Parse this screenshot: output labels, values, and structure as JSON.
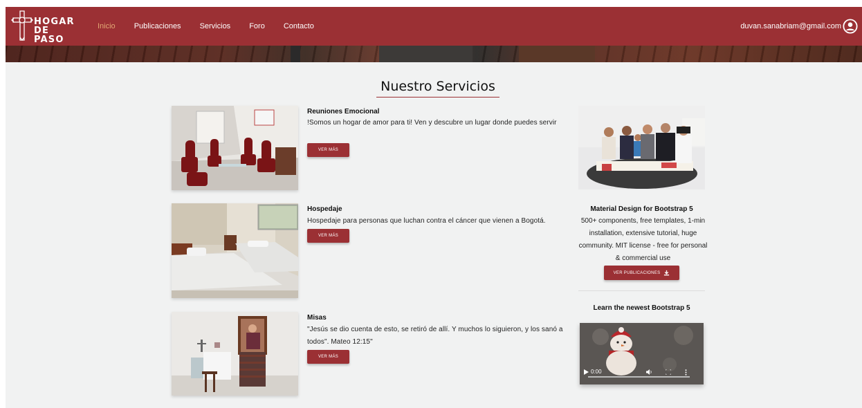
{
  "navbar": {
    "logo_line1": "HOGAR",
    "logo_line2": "DE PASO",
    "links": [
      "Inicio",
      "Publicaciones",
      "Servicios",
      "Foro",
      "Contacto"
    ],
    "active_link": "Inicio",
    "user_email": "duvan.sanabriam@gmail.com",
    "user_icon": "account-circle-icon",
    "brand_color": "#9b3034",
    "active_color": "#e2a874"
  },
  "page": {
    "section_title": "Nuestro Servicios"
  },
  "services": [
    {
      "title": "Reuniones Emocional",
      "description": "!Somos un hogar de amor para ti! Ven y descubre un lugar donde puedes servir",
      "button": "VER MÁS",
      "image": "living-room-photo"
    },
    {
      "title": "Hospedaje",
      "description": "Hospedaje para personas que luchan contra el cáncer que vienen a Bogotá.",
      "button": "VER MÁS",
      "image": "bedroom-photo"
    },
    {
      "title": "Misas",
      "description": "\"Jesús se dio cuenta de esto, se retiró de allí. Y muchos lo siguieron, y los sanó a todos\". Mateo 12:15\"",
      "button": "VER MÁS",
      "image": "chapel-altar-photo"
    }
  ],
  "sidebar": {
    "image": "group-meeting-photo",
    "title": "Material Design for Bootstrap 5",
    "description": "500+ components, free templates, 1-min installation, extensive tutorial, huge community. MIT license - free for personal & commercial use",
    "button": "VER PUBLICACIONES",
    "button_icon": "download-icon",
    "subtitle": "Learn the newest Bootstrap 5",
    "video": {
      "time": "0:00",
      "thumbnail": "snowman-plush-photo"
    }
  }
}
